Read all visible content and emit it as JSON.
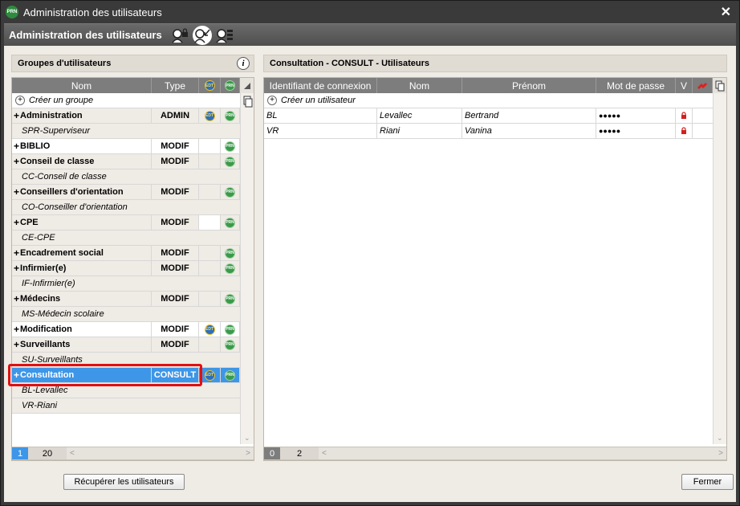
{
  "window": {
    "title": "Administration des utilisateurs",
    "close": "✕"
  },
  "toolbar": {
    "title": "Administration des utilisateurs"
  },
  "left_panel": {
    "title": "Groupes d'utilisateurs",
    "info": "i",
    "columns": [
      "Nom",
      "Type",
      "EDT",
      "PRN"
    ],
    "create_label": "Créer un groupe",
    "rows": [
      {
        "kind": "group",
        "name": "Administration",
        "type": "ADMIN",
        "edt": true,
        "prn": true,
        "style": "grey"
      },
      {
        "kind": "user",
        "name": "SPR-Superviseur"
      },
      {
        "kind": "group",
        "name": "BIBLIO",
        "type": "MODIF",
        "edt": false,
        "prn": true,
        "style": "white"
      },
      {
        "kind": "group",
        "name": "Conseil de classe",
        "type": "MODIF",
        "edt": false,
        "prn": true,
        "style": "grey"
      },
      {
        "kind": "user",
        "name": "CC-Conseil de classe"
      },
      {
        "kind": "group",
        "name": "Conseillers d'orientation",
        "type": "MODIF",
        "edt": false,
        "prn": true,
        "style": "grey"
      },
      {
        "kind": "user",
        "name": "CO-Conseiller d'orientation"
      },
      {
        "kind": "group",
        "name": "CPE",
        "type": "MODIF",
        "edt": false,
        "prn": true,
        "style": "grey",
        "edt_white": true
      },
      {
        "kind": "user",
        "name": "CE-CPE"
      },
      {
        "kind": "group",
        "name": "Encadrement social",
        "type": "MODIF",
        "edt": false,
        "prn": true,
        "style": "grey"
      },
      {
        "kind": "group",
        "name": "Infirmier(e)",
        "type": "MODIF",
        "edt": false,
        "prn": true,
        "style": "grey"
      },
      {
        "kind": "user",
        "name": "IF-Infirmier(e)"
      },
      {
        "kind": "group",
        "name": "Médecins",
        "type": "MODIF",
        "edt": false,
        "prn": true,
        "style": "grey"
      },
      {
        "kind": "user",
        "name": "MS-Médecin scolaire"
      },
      {
        "kind": "group",
        "name": "Modification",
        "type": "MODIF",
        "edt": true,
        "prn": true,
        "style": "white"
      },
      {
        "kind": "group",
        "name": "Surveillants",
        "type": "MODIF",
        "edt": false,
        "prn": true,
        "style": "grey"
      },
      {
        "kind": "user",
        "name": "SU-Surveillants"
      },
      {
        "kind": "group",
        "name": "Consultation",
        "type": "CONSULT",
        "edt": true,
        "prn": true,
        "style": "sel"
      },
      {
        "kind": "user",
        "name": "BL-Levallec"
      },
      {
        "kind": "user",
        "name": "VR-Riani"
      }
    ],
    "page_current": "1",
    "page_total": "20"
  },
  "right_panel": {
    "title": "Consultation - CONSULT - Utilisateurs",
    "columns": [
      "Identifiant de connexion",
      "Nom",
      "Prénom",
      "Mot de passe",
      "V"
    ],
    "create_label": "Créer un utilisateur",
    "rows": [
      {
        "id": "BL",
        "nom": "Levallec",
        "prenom": "Bertrand",
        "mdp": "●●●●●"
      },
      {
        "id": "VR",
        "nom": "Riani",
        "prenom": "Vanina",
        "mdp": "●●●●●"
      }
    ],
    "page_current": "0",
    "page_total": "2"
  },
  "buttons": {
    "recuperer": "Récupérer les utilisateurs",
    "fermer": "Fermer"
  },
  "badges": {
    "edt": "EDT",
    "prn": "PRN"
  },
  "colors": {
    "selection": "#3d96e8",
    "highlight": "#e01010",
    "header": "#7d7d7d"
  }
}
